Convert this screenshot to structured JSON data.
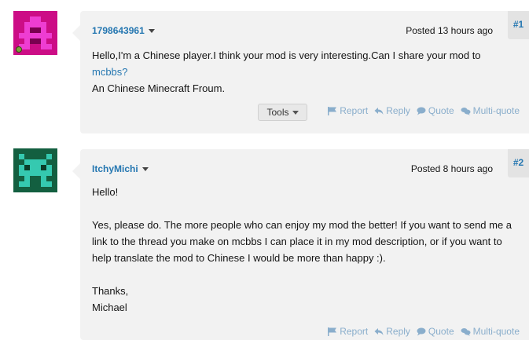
{
  "posts": [
    {
      "author": "1798643961",
      "posted": "Posted 13 hours ago",
      "number": "#1",
      "online": true,
      "avatar_colors": {
        "bg": "#cc0d86",
        "fg": "#ee3dd2",
        "dark": "#7a0050"
      },
      "paragraphs": [
        {
          "pre": "Hello,I'm a Chinese player.I think your mod is very interesting.Can I share your mod to ",
          "link": "mcbbs?"
        },
        {
          "text": "An Chinese Minecraft Froum."
        }
      ],
      "tools_label": "Tools",
      "actions": {
        "report": "Report",
        "reply": "Reply",
        "quote": "Quote",
        "multiquote": "Multi-quote"
      }
    },
    {
      "author": "ItchyMichi",
      "posted": "Posted 8 hours ago",
      "number": "#2",
      "avatar_colors": {
        "bg": "#135f40",
        "fg": "#35c9b0",
        "dark": "#0b3d29"
      },
      "paragraphs": [
        {
          "text": "Hello!"
        },
        {
          "text": "Yes, please do. The more people who can enjoy my mod the better! If you want to send me a link to the thread you make on mcbbs I can place it in my mod description, or if you want to help translate the mod to Chinese I would be more than happy :)."
        },
        {
          "text": "Thanks,"
        },
        {
          "text": "Michael"
        }
      ],
      "actions": {
        "report": "Report",
        "reply": "Reply",
        "quote": "Quote",
        "multiquote": "Multi-quote"
      }
    }
  ],
  "icons": {
    "report": "flag-icon",
    "reply": "reply-arrow-icon",
    "quote": "quote-bubble-icon",
    "multiquote": "multi-quote-bubbles-icon"
  },
  "colors": {
    "link": "#2577b1",
    "action": "#8aaecc",
    "bubble": "#f2f2f2"
  }
}
